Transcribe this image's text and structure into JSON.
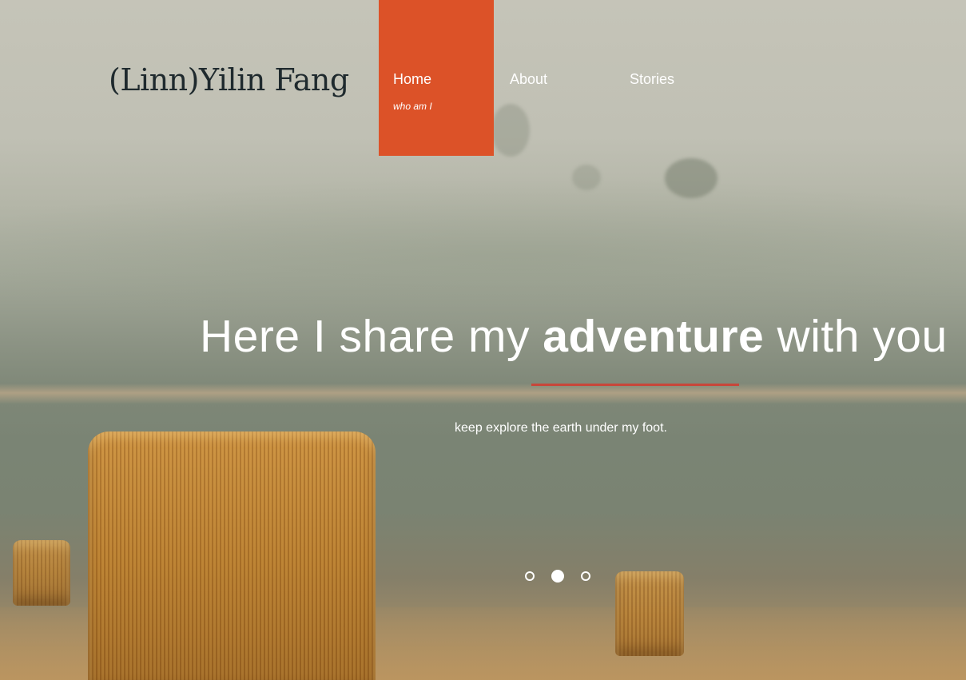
{
  "header": {
    "brand": "(Linn)Yilin Fang"
  },
  "nav": {
    "items": [
      {
        "label": "Home",
        "sub": "who am I",
        "active": true
      },
      {
        "label": "About",
        "active": false
      },
      {
        "label": "Stories",
        "active": false
      }
    ]
  },
  "hero": {
    "headline_pre": "Here I share my ",
    "headline_strong": "adventure",
    "headline_post": " with you",
    "subline": "keep explore the earth under my foot.",
    "slides_count": 3,
    "active_slide": 2
  },
  "colors": {
    "accent": "#dc5228",
    "underline": "#c8463a",
    "brand_text": "#1f2a2e"
  }
}
